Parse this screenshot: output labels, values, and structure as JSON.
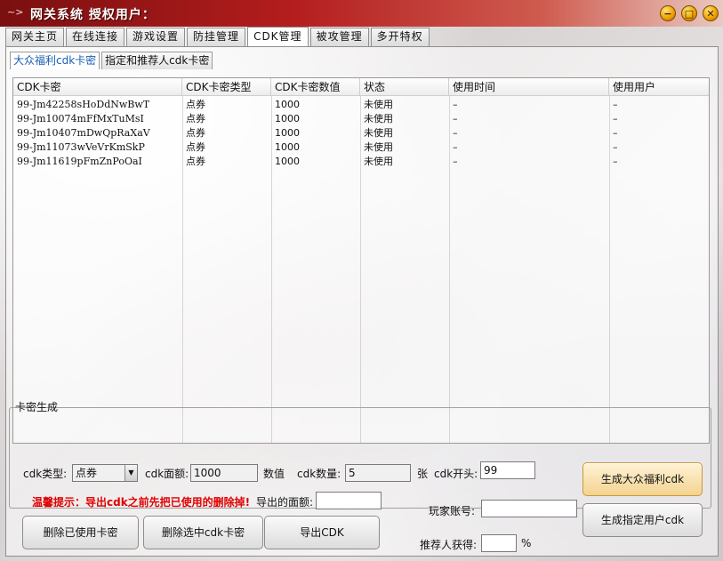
{
  "window": {
    "title": "网关系统  授权用户：",
    "logo_icon": "~>"
  },
  "main_tabs": [
    "网关主页",
    "在线连接",
    "游戏设置",
    "防挂管理",
    "CDK管理",
    "被攻管理",
    "多开特权"
  ],
  "sub_tabs": [
    "大众福利cdk卡密",
    "指定和推荐人cdk卡密"
  ],
  "table": {
    "columns": [
      "CDK卡密",
      "CDK卡密类型",
      "CDK卡密数值",
      "状态",
      "使用时间",
      "使用用户"
    ],
    "rows": [
      [
        "99-Jm42258sHoDdNwBwT",
        "点券",
        "1000",
        "未使用",
        "–",
        "–"
      ],
      [
        "99-Jm10074mFfMxTuMsI",
        "点券",
        "1000",
        "未使用",
        "–",
        "–"
      ],
      [
        "99-Jm10407mDwQpRaXaV",
        "点券",
        "1000",
        "未使用",
        "–",
        "–"
      ],
      [
        "99-Jm11073wVeVrKmSkP",
        "点券",
        "1000",
        "未使用",
        "–",
        "–"
      ],
      [
        "99-Jm11619pFmZnPoOaI",
        "点券",
        "1000",
        "未使用",
        "–",
        "–"
      ]
    ]
  },
  "generator": {
    "group_label": "卡密生成",
    "cdk_type_label": "cdk类型:",
    "cdk_type_value": "点券",
    "cdk_amount_label": "cdk面额:",
    "cdk_amount_value": "1000",
    "amount_unit": "数值",
    "cdk_count_label": "cdk数量:",
    "cdk_count_value": "5",
    "count_unit": "张",
    "cdk_prefix_label": "cdk开头:",
    "cdk_prefix_value": "99",
    "warning": "温馨提示：导出cdk之前先把已使用的删除掉!",
    "export_amount_label": "导出的面额:",
    "export_amount_value": "",
    "player_account_label": "玩家账号:",
    "player_account_value": "",
    "referrer_label": "推荐人获得:",
    "referrer_value": "",
    "percent": "%",
    "btn_delete_used": "删除已使用卡密",
    "btn_delete_selected": "删除选中cdk卡密",
    "btn_export": "导出CDK",
    "btn_gen_public": "生成大众福利cdk",
    "btn_gen_user": "生成指定用户cdk"
  }
}
